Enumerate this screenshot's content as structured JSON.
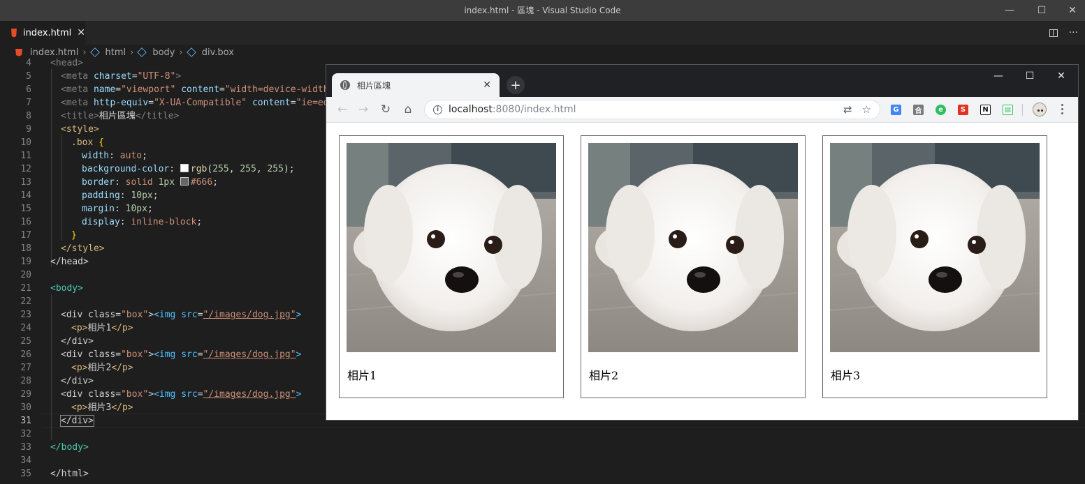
{
  "window": {
    "title": "index.html - 區塊 - Visual Studio Code",
    "controls": {
      "minimize": "—",
      "maximize": "☐",
      "close": "✕"
    }
  },
  "editor_tab": {
    "label": "index.html",
    "close": "✕"
  },
  "breadcrumb": [
    "index.html",
    "html",
    "body",
    "div.box"
  ],
  "code_lines": [
    {
      "n": "4"
    },
    {
      "n": "5"
    },
    {
      "n": "6"
    },
    {
      "n": "7"
    },
    {
      "n": "8"
    },
    {
      "n": "9"
    },
    {
      "n": "10"
    },
    {
      "n": "11"
    },
    {
      "n": "12"
    },
    {
      "n": "13"
    },
    {
      "n": "14"
    },
    {
      "n": "15"
    },
    {
      "n": "16"
    },
    {
      "n": "17"
    },
    {
      "n": "18"
    },
    {
      "n": "19"
    },
    {
      "n": "20"
    },
    {
      "n": "21"
    },
    {
      "n": "22"
    },
    {
      "n": "23"
    },
    {
      "n": "24"
    },
    {
      "n": "25"
    },
    {
      "n": "26"
    },
    {
      "n": "27"
    },
    {
      "n": "28"
    },
    {
      "n": "29"
    },
    {
      "n": "30"
    },
    {
      "n": "31"
    },
    {
      "n": "32"
    },
    {
      "n": "33"
    },
    {
      "n": "34"
    },
    {
      "n": "35"
    }
  ],
  "code": {
    "l4": "<head>",
    "l5_a": "<meta ",
    "l5_b": "charset",
    "l5_c": "=",
    "l5_d": "\"UTF-8\"",
    "l5_e": ">",
    "l6_a": "<meta ",
    "l6_b": "name",
    "l6_c": "=",
    "l6_d": "\"viewport\"",
    "l6_e": " content",
    "l6_f": "=",
    "l6_g": "\"width=device-width,",
    "l7_a": "<meta ",
    "l7_b": "http-equiv",
    "l7_c": "=",
    "l7_d": "\"X-UA-Compatible\"",
    "l7_e": " content",
    "l7_f": "=",
    "l7_g": "\"ie=ed",
    "l8_a": "<title>",
    "l8_b": "相片區塊",
    "l8_c": "</title>",
    "l9": "<style>",
    "l10_a": ".box",
    "l10_b": " {",
    "l11_a": "width",
    "l11_b": ": ",
    "l11_c": "auto",
    "l11_d": ";",
    "l12_a": "background-color",
    "l12_b": ": ",
    "l12_c": "rgb",
    "l12_d": "(",
    "l12_e": "255",
    "l12_f": ", ",
    "l12_g": "255",
    "l12_h": ", ",
    "l12_i": "255",
    "l12_j": ");",
    "l13_a": "border",
    "l13_b": ": ",
    "l13_c": "solid ",
    "l13_d": "1px",
    "l13_e": " ",
    "l13_f": "#666",
    "l13_g": ";",
    "l14_a": "padding",
    "l14_b": ": ",
    "l14_c": "10px",
    "l14_d": ";",
    "l15_a": "margin",
    "l15_b": ": ",
    "l15_c": "10px",
    "l15_d": ";",
    "l16_a": "display",
    "l16_b": ": ",
    "l16_c": "inline-block",
    "l16_d": ";",
    "l17": "}",
    "l18": "</style>",
    "l19": "</head>",
    "l21": "<body>",
    "div_open": "<div ",
    "class_attr": "class",
    "eq": "=",
    "box_str": "\"box\"",
    "gt": ">",
    "img_open": "<img ",
    "src_attr": "src",
    "src_val": "\"/images/dog.jpg\"",
    "p_open": "<p>",
    "p_close": "</p>",
    "p1": "相片1",
    "p2": "相片2",
    "p3": "相片3",
    "div_close": "</div>",
    "l33": "</body>",
    "l35": "</html>"
  },
  "colors": {
    "swatch_white": "#ffffff",
    "swatch_666": "#666666"
  },
  "browser": {
    "tab_title": "相片區塊",
    "tab_close": "✕",
    "new_tab": "+",
    "url_host": "localhost",
    "url_rest": ":8080/index.html",
    "controls": {
      "minimize": "—",
      "maximize": "☐",
      "close": "✕"
    },
    "extensions": [
      {
        "name": "google-translate-icon",
        "color": "#4285f4",
        "glyph": "G"
      },
      {
        "name": "extension-box-icon",
        "color": "#7a7a7a",
        "glyph": "合"
      },
      {
        "name": "evernote-icon",
        "color": "#2dbe60",
        "glyph": "e"
      },
      {
        "name": "s-extension-icon",
        "color": "#e0321e",
        "glyph": "S"
      },
      {
        "name": "notion-icon",
        "color": "#111111",
        "glyph": "N"
      },
      {
        "name": "shopping-bag-icon",
        "color": "#2dbe60",
        "glyph": "▤"
      }
    ]
  },
  "gallery": [
    {
      "caption": "相片1"
    },
    {
      "caption": "相片2"
    },
    {
      "caption": "相片3"
    }
  ]
}
